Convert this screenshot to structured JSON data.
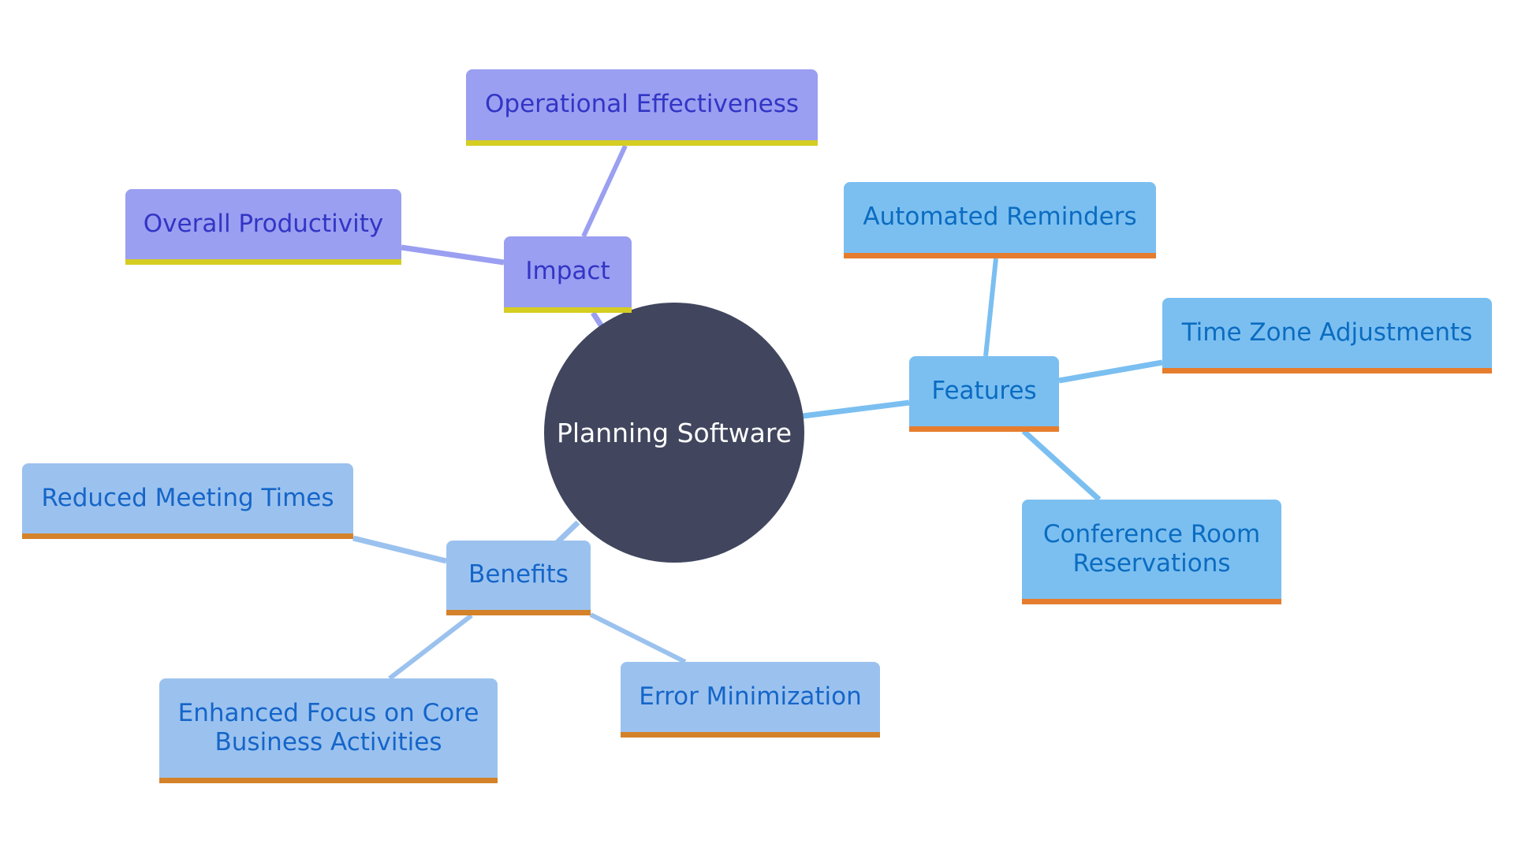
{
  "mindmap": {
    "root": {
      "label": "Planning Software",
      "color": "#41465e",
      "text_color": "#ffffff"
    },
    "branches": [
      {
        "id": "impact",
        "label": "Impact",
        "fill": "#9a9ff1",
        "text_color": "#3235c4",
        "accent": "#d5cd22",
        "edge_color": "#9a9ff1",
        "children": [
          {
            "label": "Operational Effectiveness"
          },
          {
            "label": "Overall Productivity"
          }
        ]
      },
      {
        "id": "features",
        "label": "Features",
        "fill": "#7bbff1",
        "text_color": "#0b6cc0",
        "accent": "#e67d2e",
        "edge_color": "#7bbff1",
        "children": [
          {
            "label": "Automated Reminders"
          },
          {
            "label": "Time Zone Adjustments"
          },
          {
            "label": "Conference Room\nReservations"
          }
        ]
      },
      {
        "id": "benefits",
        "label": "Benefits",
        "fill": "#9bc2ef",
        "text_color": "#1565c8",
        "accent": "#d4822a",
        "edge_color": "#9bc2ef",
        "children": [
          {
            "label": "Reduced Meeting Times"
          },
          {
            "label": "Enhanced Focus on Core\nBusiness Activities"
          },
          {
            "label": "Error Minimization"
          }
        ]
      }
    ]
  }
}
